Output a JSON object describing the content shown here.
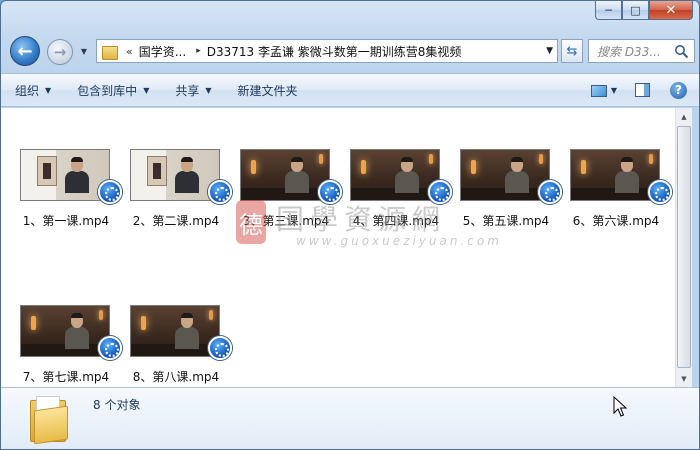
{
  "window": {
    "controls": {
      "minimize": "─",
      "maximize": "□",
      "close": "✕"
    }
  },
  "navigation": {
    "back_icon": "back-arrow-icon",
    "forward_icon": "forward-arrow-icon",
    "address": {
      "overflow": "«",
      "segments": [
        "国学资...",
        "D33713 李孟谦 紫微斗数第一期训练营8集视频"
      ],
      "separator": "▸"
    },
    "refresh_icon": "refresh-icon",
    "search_placeholder": "搜索 D33..."
  },
  "command_bar": {
    "items": [
      {
        "label": "组织",
        "has_menu": true
      },
      {
        "label": "包含到库中",
        "has_menu": true
      },
      {
        "label": "共享",
        "has_menu": true
      },
      {
        "label": "新建文件夹",
        "has_menu": false
      }
    ],
    "help": "?"
  },
  "files": [
    {
      "name": "1、第一课.mp4",
      "style": "light"
    },
    {
      "name": "2、第二课.mp4",
      "style": "light"
    },
    {
      "name": "3、第三课.mp4",
      "style": "dark"
    },
    {
      "name": "4、第四课.mp4",
      "style": "dark"
    },
    {
      "name": "5、第五课.mp4",
      "style": "dark"
    },
    {
      "name": "6、第六课.mp4",
      "style": "dark"
    },
    {
      "name": "7、第七课.mp4",
      "style": "dark"
    },
    {
      "name": "8、第八课.mp4",
      "style": "dark"
    }
  ],
  "watermark": {
    "seal": "德",
    "title": "国學資源網",
    "url": "www.guoxueziyuan.com"
  },
  "details": {
    "status": "8 个对象"
  }
}
